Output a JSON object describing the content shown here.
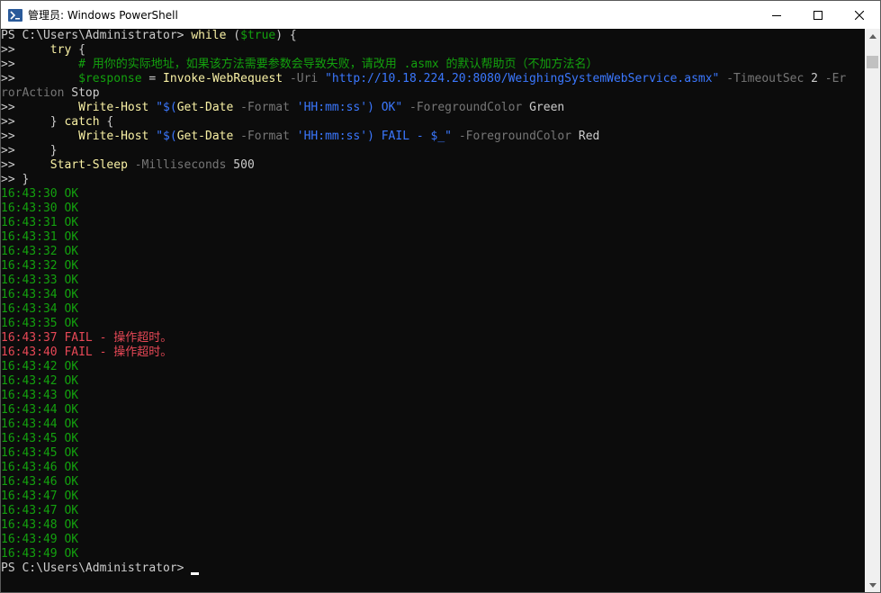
{
  "window": {
    "title": "管理员: Windows PowerShell"
  },
  "colors": {
    "ok": "#13a10e",
    "fail": "#e74856",
    "string": "#3b78ff",
    "parameter": "#767676",
    "comment": "#13a10e",
    "background": "#0c0c0c"
  },
  "terminal": {
    "cmd": {
      "prompt": "PS C:\\Users\\Administrator> ",
      "while_kw": "while",
      "while_cond_open": " (",
      "while_var": "$true",
      "while_cond_close": ") {",
      "cont": ">> ",
      "try_kw": "try",
      "try_brace": " {",
      "comment": "# 用你的实际地址，如果该方法需要参数会导致失败，请改用 .asmx 的默认帮助页（不加方法名）",
      "resp_var": "$response",
      "eq": " = ",
      "invoke_cmd": "Invoke-WebRequest",
      "uri_param": "-Uri",
      "uri_value": "\"http://10.18.224.20:8080/WeighingSystemWebService.asmx\"",
      "timeout_param": "-TimeoutSec",
      "timeout_value": "2",
      "ea_param_part1": "-Er",
      "ea_param_part2": "rorAction",
      "ea_value": "Stop",
      "write_cmd": "Write-Host",
      "ok_str_a": "\"$(",
      "get_date": "Get-Date",
      "format_param": "-Format",
      "format_str": "'HH:mm:ss'",
      "ok_str_b": ") OK\"",
      "fg_param": "-ForegroundColor",
      "green": "Green",
      "catch_open": "} ",
      "catch_kw": "catch",
      "catch_brace": " {",
      "fail_str_b": ") FAIL - $_\"",
      "red": "Red",
      "close_brace": "}",
      "sleep_cmd": "Start-Sleep",
      "ms_param": "-Milliseconds",
      "ms_value": "500",
      "end_brace": "}"
    },
    "output": [
      {
        "text": "16:43:30 OK",
        "status": "ok"
      },
      {
        "text": "16:43:30 OK",
        "status": "ok"
      },
      {
        "text": "16:43:31 OK",
        "status": "ok"
      },
      {
        "text": "16:43:31 OK",
        "status": "ok"
      },
      {
        "text": "16:43:32 OK",
        "status": "ok"
      },
      {
        "text": "16:43:32 OK",
        "status": "ok"
      },
      {
        "text": "16:43:33 OK",
        "status": "ok"
      },
      {
        "text": "16:43:34 OK",
        "status": "ok"
      },
      {
        "text": "16:43:34 OK",
        "status": "ok"
      },
      {
        "text": "16:43:35 OK",
        "status": "ok"
      },
      {
        "text": "16:43:37 FAIL - 操作超时。",
        "status": "fail"
      },
      {
        "text": "16:43:40 FAIL - 操作超时。",
        "status": "fail"
      },
      {
        "text": "16:43:42 OK",
        "status": "ok"
      },
      {
        "text": "16:43:42 OK",
        "status": "ok"
      },
      {
        "text": "16:43:43 OK",
        "status": "ok"
      },
      {
        "text": "16:43:44 OK",
        "status": "ok"
      },
      {
        "text": "16:43:44 OK",
        "status": "ok"
      },
      {
        "text": "16:43:45 OK",
        "status": "ok"
      },
      {
        "text": "16:43:45 OK",
        "status": "ok"
      },
      {
        "text": "16:43:46 OK",
        "status": "ok"
      },
      {
        "text": "16:43:46 OK",
        "status": "ok"
      },
      {
        "text": "16:43:47 OK",
        "status": "ok"
      },
      {
        "text": "16:43:47 OK",
        "status": "ok"
      },
      {
        "text": "16:43:48 OK",
        "status": "ok"
      },
      {
        "text": "16:43:49 OK",
        "status": "ok"
      },
      {
        "text": "16:43:49 OK",
        "status": "ok"
      }
    ],
    "final_prompt": "PS C:\\Users\\Administrator> "
  },
  "icons": {
    "app": "powershell-icon",
    "minimize": "minimize-icon",
    "maximize": "maximize-icon",
    "close": "close-icon",
    "scroll_up": "scroll-up-arrow-icon",
    "scroll_down": "scroll-down-arrow-icon"
  }
}
